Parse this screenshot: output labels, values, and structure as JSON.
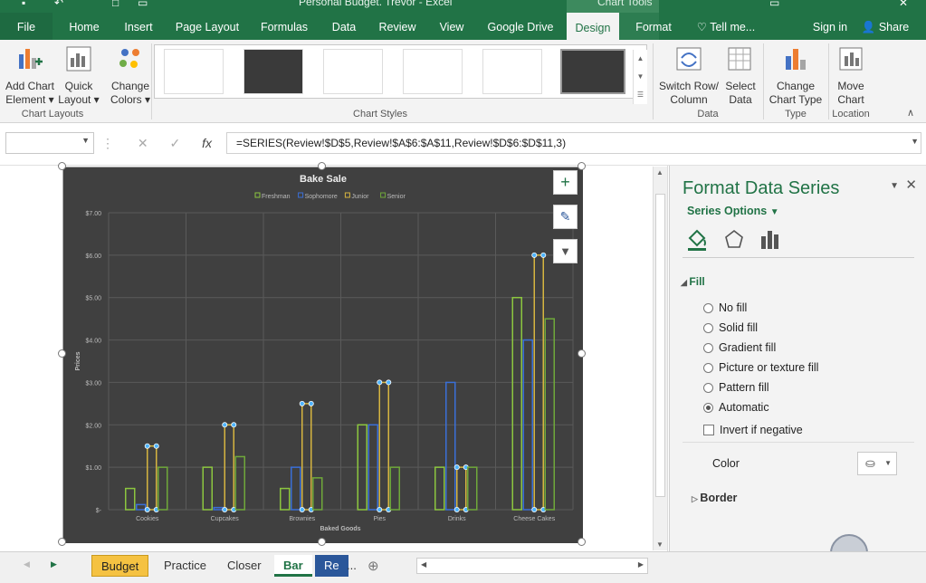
{
  "window": {
    "title": "Personal Budget. Trevor - Excel",
    "context_tab": "Chart Tools"
  },
  "tabs": [
    {
      "label": "File"
    },
    {
      "label": "Home"
    },
    {
      "label": "Insert"
    },
    {
      "label": "Page Layout"
    },
    {
      "label": "Formulas"
    },
    {
      "label": "Data"
    },
    {
      "label": "Review"
    },
    {
      "label": "View"
    },
    {
      "label": "Google Drive"
    },
    {
      "label": "Design"
    },
    {
      "label": "Format"
    }
  ],
  "tell_me": "Tell me...",
  "sign_in": "Sign in",
  "share": "Share",
  "ribbon": {
    "add_chart_element": [
      "Add Chart",
      "Element"
    ],
    "quick_layout": [
      "Quick",
      "Layout"
    ],
    "change_colors": [
      "Change",
      "Colors"
    ],
    "group_chart_layouts": "Chart Layouts",
    "group_chart_styles": "Chart Styles",
    "switch_row_col": [
      "Switch Row/",
      "Column"
    ],
    "select_data": [
      "Select",
      "Data"
    ],
    "group_data": "Data",
    "change_chart_type": [
      "Change",
      "Chart Type"
    ],
    "group_type": "Type",
    "move_chart": [
      "Move",
      "Chart"
    ],
    "group_location": "Location"
  },
  "formula_bar": {
    "name_box": "",
    "formula": "=SERIES(Review!$D$5,Review!$A$6:$A$11,Review!$D$6:$D$11,3)"
  },
  "chart_data": {
    "type": "bar",
    "title": "Bake Sale",
    "xlabel": "Baked Goods",
    "ylabel": "Prices",
    "ylim": [
      0,
      7
    ],
    "yticks": [
      "$-",
      "$1.00",
      "$2.00",
      "$3.00",
      "$4.00",
      "$5.00",
      "$6.00",
      "$7.00"
    ],
    "categories": [
      "Cookies",
      "Cupcakes",
      "Brownies",
      "Pies",
      "Drinks",
      "Cheese Cakes"
    ],
    "series": [
      {
        "name": "Freshman",
        "color": "#8cc63f",
        "values": [
          0.5,
          1.0,
          0.5,
          2.0,
          1.0,
          5.0
        ]
      },
      {
        "name": "Sophomore",
        "color": "#3a6fd8",
        "values": [
          0.12,
          0.05,
          1.0,
          2.0,
          3.0,
          4.0
        ]
      },
      {
        "name": "Junior",
        "color": "#d6b540",
        "values": [
          1.5,
          2.0,
          2.5,
          3.0,
          1.0,
          6.0
        ]
      },
      {
        "name": "Senior",
        "color": "#6fa83a",
        "values": [
          1.0,
          1.25,
          0.75,
          1.0,
          1.0,
          4.5
        ]
      }
    ],
    "selected_series": "Junior",
    "legend_position": "top",
    "grid": true,
    "background": "#404040"
  },
  "pane": {
    "title": "Format Data Series",
    "series_options": "Series Options",
    "fill_header": "Fill",
    "options": [
      {
        "label": "No fill",
        "checked": false
      },
      {
        "label": "Solid fill",
        "checked": false
      },
      {
        "label": "Gradient fill",
        "checked": false
      },
      {
        "label": "Picture or texture fill",
        "checked": false
      },
      {
        "label": "Pattern fill",
        "checked": false
      },
      {
        "label": "Automatic",
        "checked": true
      }
    ],
    "invert": "Invert if negative",
    "color_label": "Color",
    "border_label": "Border"
  },
  "sheet_tabs": [
    "Budget",
    "Practice",
    "Closer",
    "Bar",
    "Re",
    "..."
  ]
}
